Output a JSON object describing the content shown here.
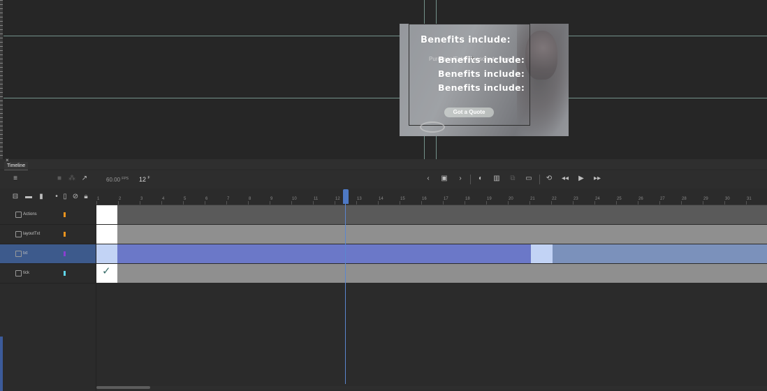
{
  "stage": {
    "headline_top": "Benefits include:",
    "headline_repeats": [
      "Benefits include:",
      "Benefits include:",
      "Benefits include:"
    ],
    "sub_text": "Purchase/Enter Reasons to your",
    "cta_label": "Got a Quote",
    "guide_color": "#8fb7ad"
  },
  "timeline": {
    "panel_title": "Timeline",
    "fps_value": "60.00",
    "fps_unit": "FPS",
    "frame_value": "12",
    "frame_unit": "F",
    "ruler_numbers": [
      "1",
      "2",
      "3",
      "4",
      "5",
      "6",
      "7",
      "8",
      "9",
      "10",
      "11",
      "12",
      "13",
      "14",
      "15",
      "16",
      "17",
      "18",
      "19",
      "20",
      "21",
      "22",
      "23",
      "24",
      "25",
      "26",
      "27",
      "28",
      "29",
      "30",
      "31"
    ],
    "current_frame": 12,
    "layers": [
      {
        "name": "Actions",
        "color": "#e8931e",
        "selected": false
      },
      {
        "name": "layoutTxt",
        "color": "#e8931e",
        "selected": false
      },
      {
        "name": "txt",
        "color": "#8a3fd0",
        "selected": true
      },
      {
        "name": "tick",
        "color": "#5fd5e8",
        "selected": false
      }
    ],
    "colors": {
      "accent": "#4e79c4",
      "selected_layer": "#3d5a8c",
      "tween_fill": "#6b78c8",
      "tween_hold": "#7b91bb",
      "keyframe_light": "#c2d3f5",
      "gray_frames": "#5a5a5a",
      "light_gray_frames": "#8f8f8f"
    }
  }
}
